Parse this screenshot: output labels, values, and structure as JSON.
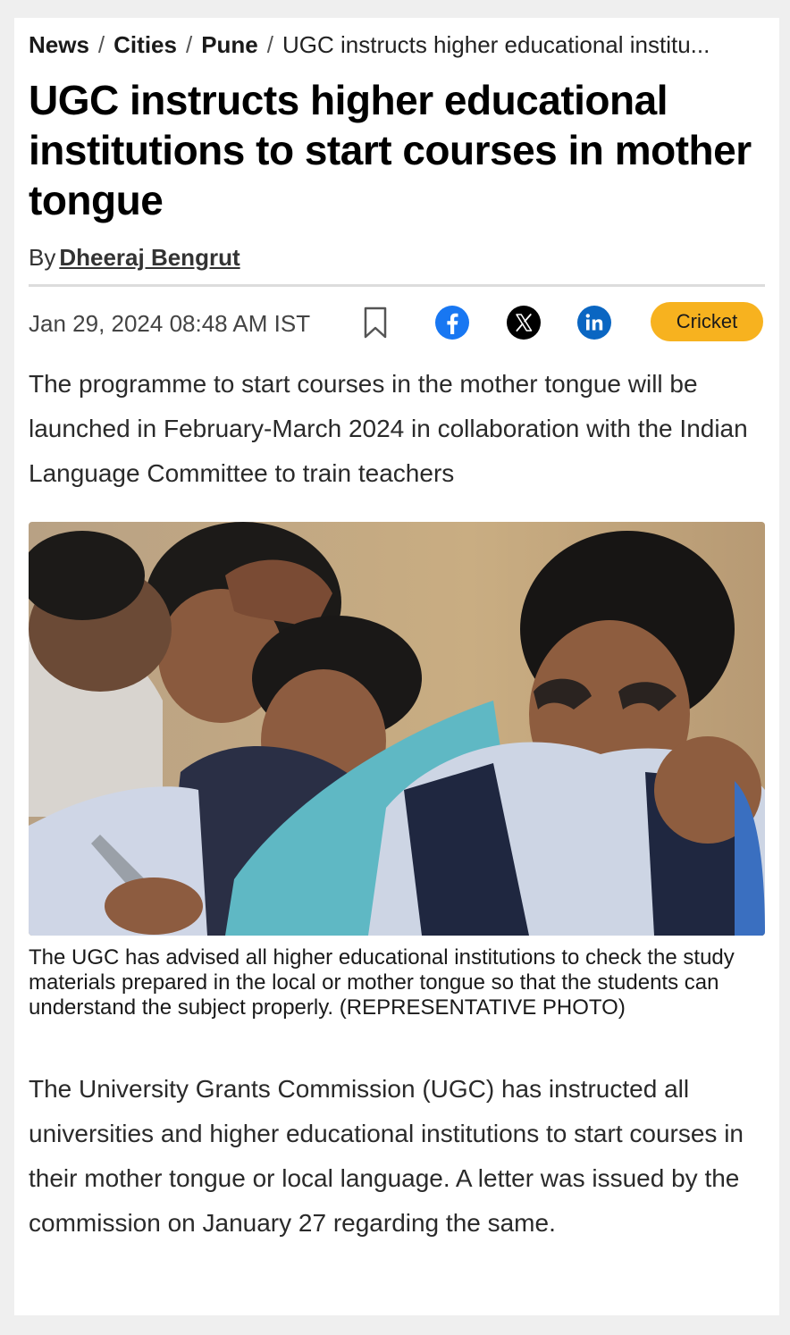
{
  "breadcrumb": {
    "items": [
      "News",
      "Cities",
      "Pune"
    ],
    "separator": "/",
    "current": "UGC instructs higher educational institu..."
  },
  "article": {
    "headline": "UGC instructs higher educational institutions to start courses in mother tongue",
    "byline_prefix": "By",
    "author": "Dheeraj Bengrut",
    "timestamp": "Jan 29, 2024 08:48 AM IST",
    "tag": "Cricket",
    "summary": "The programme to start courses in the mother tongue will be launched in February-March 2024 in collaboration with the Indian Language Committee to train teachers",
    "image_caption": "The UGC has advised all higher educational institutions to check the study materials prepared in the local or mother tongue so that the students can understand the subject properly. (REPRESENTATIVE PHOTO)",
    "body": "The University Grants Commission (UGC) has instructed all universities and higher educational institutions to start courses in their mother tongue or local language. A letter was issued by the commission on January 27 regarding the same."
  },
  "share": {
    "icons": [
      "bookmark-icon",
      "facebook-icon",
      "x-icon",
      "linkedin-icon"
    ]
  },
  "colors": {
    "tag_background": "#f7b21f",
    "facebook": "#1877f2",
    "linkedin": "#0a66c2",
    "x": "#000000"
  }
}
